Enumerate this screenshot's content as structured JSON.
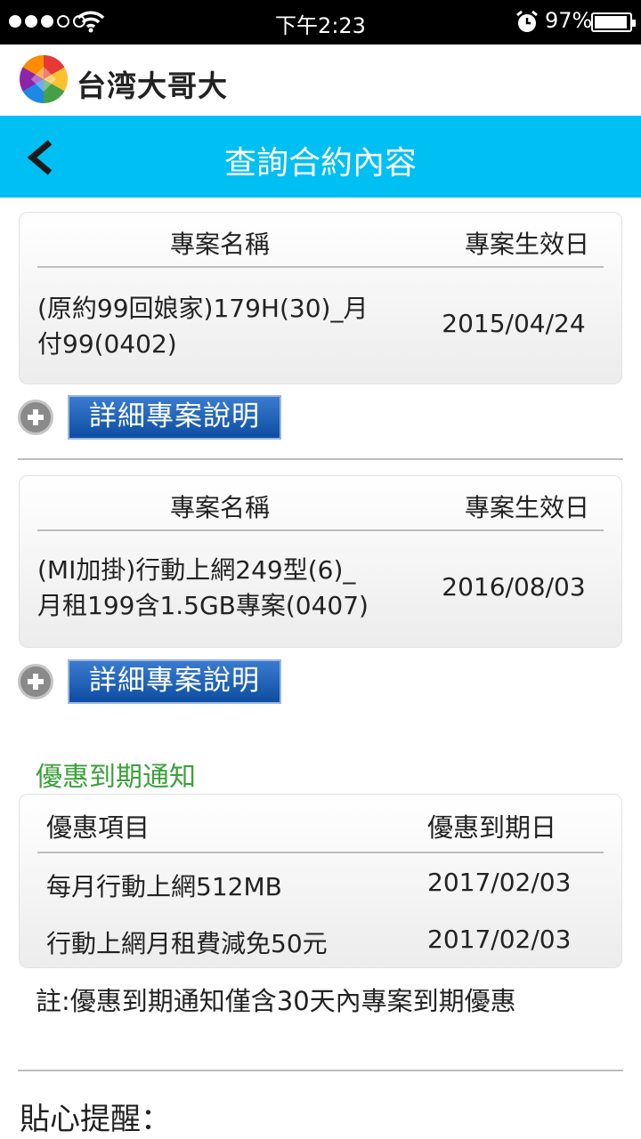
{
  "status_bar": {
    "time": "下午2:23",
    "battery_percent": "97%",
    "battery_level": 0.97,
    "signal_bars_filled": 3,
    "signal_bars_total": 5
  },
  "brand": {
    "name": "台湾大哥大"
  },
  "header": {
    "title": "查詢合約內容"
  },
  "contracts": [
    {
      "name_header": "專案名稱",
      "date_header": "專案生效日",
      "name_line1": "(原約99回娘家)179H(30)_月",
      "name_line2": "付99(0402)",
      "date": "2015/04/24",
      "detail_label": "詳細專案說明"
    },
    {
      "name_header": "專案名稱",
      "date_header": "專案生效日",
      "name_line1": "(MI加掛)行動上網249型(6)_",
      "name_line2": "月租199含1.5GB專案(0407)",
      "date": "2016/08/03",
      "detail_label": "詳細專案說明"
    }
  ],
  "promotions": {
    "section_title": "優惠到期通知",
    "item_header": "優惠項目",
    "date_header": "優惠到期日",
    "rows": [
      {
        "item": "每月行動上網512MB",
        "date": "2017/02/03"
      },
      {
        "item": "行動上網月租費減免50元",
        "date": "2017/02/03"
      }
    ],
    "note": "註:優惠到期通知僅含30天內專案到期優惠"
  },
  "tips": {
    "title": "貼心提醒："
  },
  "colors": {
    "accent": "#00bff3",
    "section_green": "#3aa23a",
    "detail_button": "#0d4ea1"
  }
}
